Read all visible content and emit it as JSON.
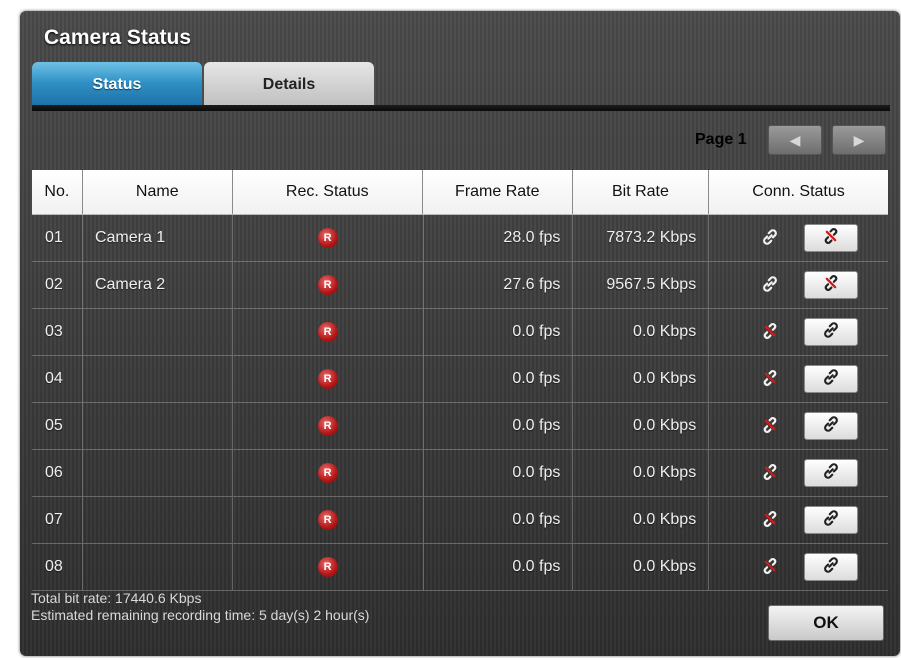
{
  "window": {
    "title": "Camera Status"
  },
  "tabs": [
    {
      "label": "Status",
      "active": true
    },
    {
      "label": "Details",
      "active": false
    }
  ],
  "pager": {
    "label": "Page 1",
    "prev_icon": "triangle-left-icon",
    "next_icon": "triangle-right-icon"
  },
  "table": {
    "headers": [
      "No.",
      "Name",
      "Rec. Status",
      "Frame Rate",
      "Bit Rate",
      "Conn. Status"
    ],
    "rec_badge": "R",
    "rows": [
      {
        "no": "01",
        "name": "Camera 1",
        "frame_rate": "28.0 fps",
        "bit_rate": "7873.2 Kbps",
        "connected": true
      },
      {
        "no": "02",
        "name": "Camera 2",
        "frame_rate": "27.6 fps",
        "bit_rate": "9567.5 Kbps",
        "connected": true
      },
      {
        "no": "03",
        "name": "",
        "frame_rate": "0.0 fps",
        "bit_rate": "0.0 Kbps",
        "connected": false
      },
      {
        "no": "04",
        "name": "",
        "frame_rate": "0.0 fps",
        "bit_rate": "0.0 Kbps",
        "connected": false
      },
      {
        "no": "05",
        "name": "",
        "frame_rate": "0.0 fps",
        "bit_rate": "0.0 Kbps",
        "connected": false
      },
      {
        "no": "06",
        "name": "",
        "frame_rate": "0.0 fps",
        "bit_rate": "0.0 Kbps",
        "connected": false
      },
      {
        "no": "07",
        "name": "",
        "frame_rate": "0.0 fps",
        "bit_rate": "0.0 Kbps",
        "connected": false
      },
      {
        "no": "08",
        "name": "",
        "frame_rate": "0.0 fps",
        "bit_rate": "0.0 Kbps",
        "connected": false
      }
    ]
  },
  "footer": {
    "total_bit_rate": "Total bit rate: 17440.6 Kbps",
    "remaining_time": "Estimated remaining recording time: 5 day(s) 2 hour(s)"
  },
  "ok_label": "OK",
  "colors": {
    "accent_tab": "#2e8fc4",
    "rec_red": "#b31616",
    "broken_link_red": "#d11a1a"
  }
}
